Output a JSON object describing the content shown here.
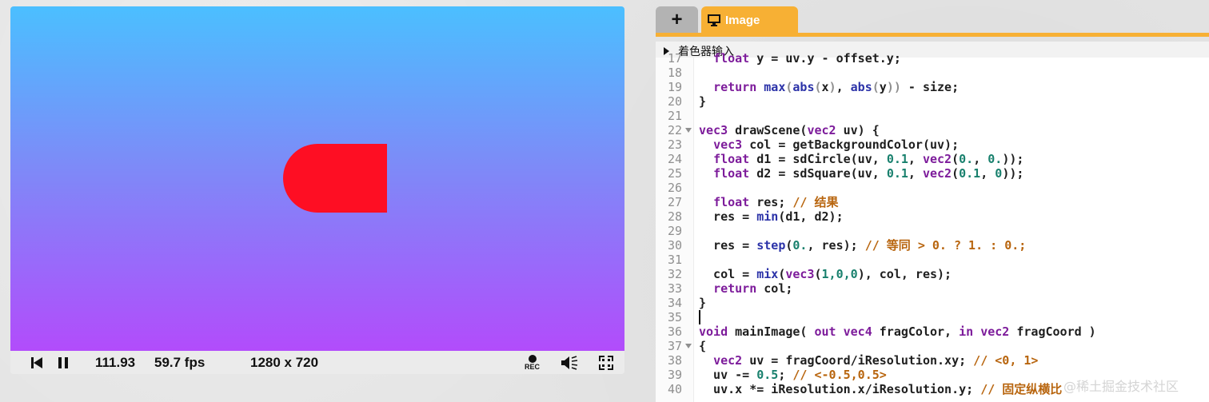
{
  "viewer": {
    "colors": {
      "top": "#4bbfff",
      "bottom": "#b24cfb",
      "shape": "#fe0e23"
    },
    "controls": {
      "time": "111.93",
      "fps": "59.7 fps",
      "resolution": "1280 x 720",
      "rec_label": "REC"
    }
  },
  "editor": {
    "tabs": {
      "add_label": "+",
      "image_label": "Image"
    },
    "section_title": "着色器输入",
    "lines": [
      {
        "n": "17",
        "fold": false,
        "tokens": [
          [
            "",
            "  "
          ],
          [
            "k",
            "float"
          ],
          [
            "",
            " y = uv.y - offset.y;"
          ]
        ]
      },
      {
        "n": "18",
        "fold": false,
        "tokens": []
      },
      {
        "n": "19",
        "fold": false,
        "tokens": [
          [
            "",
            "  "
          ],
          [
            "k",
            "return"
          ],
          [
            "",
            " "
          ],
          [
            "f",
            "max"
          ],
          [
            "p",
            "("
          ],
          [
            "f",
            "abs"
          ],
          [
            "p",
            "("
          ],
          [
            "",
            "x"
          ],
          [
            "p",
            ")"
          ],
          [
            "",
            ", "
          ],
          [
            "f",
            "abs"
          ],
          [
            "p",
            "("
          ],
          [
            "",
            "y"
          ],
          [
            "p",
            "))"
          ],
          [
            "",
            " - size;"
          ]
        ]
      },
      {
        "n": "20",
        "fold": false,
        "tokens": [
          [
            "",
            "}"
          ]
        ]
      },
      {
        "n": "21",
        "fold": false,
        "tokens": []
      },
      {
        "n": "22",
        "fold": true,
        "tokens": [
          [
            "k",
            "vec3"
          ],
          [
            "",
            " drawScene("
          ],
          [
            "k",
            "vec2"
          ],
          [
            "",
            " uv) {"
          ]
        ]
      },
      {
        "n": "23",
        "fold": false,
        "tokens": [
          [
            "",
            "  "
          ],
          [
            "k",
            "vec3"
          ],
          [
            "",
            " col = getBackgroundColor(uv);"
          ]
        ]
      },
      {
        "n": "24",
        "fold": false,
        "tokens": [
          [
            "",
            "  "
          ],
          [
            "k",
            "float"
          ],
          [
            "",
            " d1 = sdCircle(uv, "
          ],
          [
            "n",
            "0.1"
          ],
          [
            "",
            ", "
          ],
          [
            "k",
            "vec2"
          ],
          [
            "",
            "("
          ],
          [
            "n",
            "0."
          ],
          [
            "",
            ", "
          ],
          [
            "n",
            "0."
          ],
          [
            "",
            "));"
          ]
        ]
      },
      {
        "n": "25",
        "fold": false,
        "tokens": [
          [
            "",
            "  "
          ],
          [
            "k",
            "float"
          ],
          [
            "",
            " d2 = sdSquare(uv, "
          ],
          [
            "n",
            "0.1"
          ],
          [
            "",
            ", "
          ],
          [
            "k",
            "vec2"
          ],
          [
            "",
            "("
          ],
          [
            "n",
            "0.1"
          ],
          [
            "",
            ", "
          ],
          [
            "n",
            "0"
          ],
          [
            "",
            "));"
          ]
        ]
      },
      {
        "n": "26",
        "fold": false,
        "tokens": []
      },
      {
        "n": "27",
        "fold": false,
        "tokens": [
          [
            "",
            "  "
          ],
          [
            "k",
            "float"
          ],
          [
            "",
            " res; "
          ],
          [
            "c",
            "// 结果"
          ]
        ]
      },
      {
        "n": "28",
        "fold": false,
        "tokens": [
          [
            "",
            "  res = "
          ],
          [
            "f",
            "min"
          ],
          [
            "",
            "(d1, d2);"
          ]
        ]
      },
      {
        "n": "29",
        "fold": false,
        "tokens": []
      },
      {
        "n": "30",
        "fold": false,
        "tokens": [
          [
            "",
            "  res = "
          ],
          [
            "f",
            "step"
          ],
          [
            "",
            "("
          ],
          [
            "n",
            "0."
          ],
          [
            "",
            ", res); "
          ],
          [
            "c",
            "// 等同 > 0. ? 1. : 0.;"
          ]
        ]
      },
      {
        "n": "31",
        "fold": false,
        "tokens": []
      },
      {
        "n": "32",
        "fold": false,
        "tokens": [
          [
            "",
            "  col = "
          ],
          [
            "f",
            "mix"
          ],
          [
            "",
            "("
          ],
          [
            "k",
            "vec3"
          ],
          [
            "",
            "("
          ],
          [
            "n",
            "1,0,0"
          ],
          [
            "",
            "), col, res);"
          ]
        ]
      },
      {
        "n": "33",
        "fold": false,
        "tokens": [
          [
            "",
            "  "
          ],
          [
            "k",
            "return"
          ],
          [
            "",
            " col;"
          ]
        ]
      },
      {
        "n": "34",
        "fold": false,
        "tokens": [
          [
            "",
            "}"
          ]
        ]
      },
      {
        "n": "35",
        "fold": false,
        "tokens": []
      },
      {
        "n": "36",
        "fold": false,
        "tokens": [
          [
            "k",
            "void"
          ],
          [
            "",
            " mainImage( "
          ],
          [
            "k",
            "out"
          ],
          [
            "",
            " "
          ],
          [
            "k",
            "vec4"
          ],
          [
            "",
            " fragColor, "
          ],
          [
            "k",
            "in"
          ],
          [
            "",
            " "
          ],
          [
            "k",
            "vec2"
          ],
          [
            "",
            " fragCoord )"
          ]
        ]
      },
      {
        "n": "37",
        "fold": true,
        "tokens": [
          [
            "",
            "{"
          ]
        ]
      },
      {
        "n": "38",
        "fold": false,
        "tokens": [
          [
            "",
            "  "
          ],
          [
            "k",
            "vec2"
          ],
          [
            "",
            " uv = fragCoord/iResolution.xy; "
          ],
          [
            "c",
            "// <0, 1>"
          ]
        ]
      },
      {
        "n": "39",
        "fold": false,
        "tokens": [
          [
            "",
            "  uv -= "
          ],
          [
            "n",
            "0.5"
          ],
          [
            "",
            "; "
          ],
          [
            "c",
            "// <-0.5,0.5>"
          ]
        ]
      },
      {
        "n": "40",
        "fold": false,
        "tokens": [
          [
            "",
            "  uv.x *= iResolution.x/iResolution.y; "
          ],
          [
            "c",
            "// 固定纵横比"
          ]
        ]
      }
    ],
    "cursor_line": "35",
    "watermark": "@稀土掘金技术社区"
  }
}
